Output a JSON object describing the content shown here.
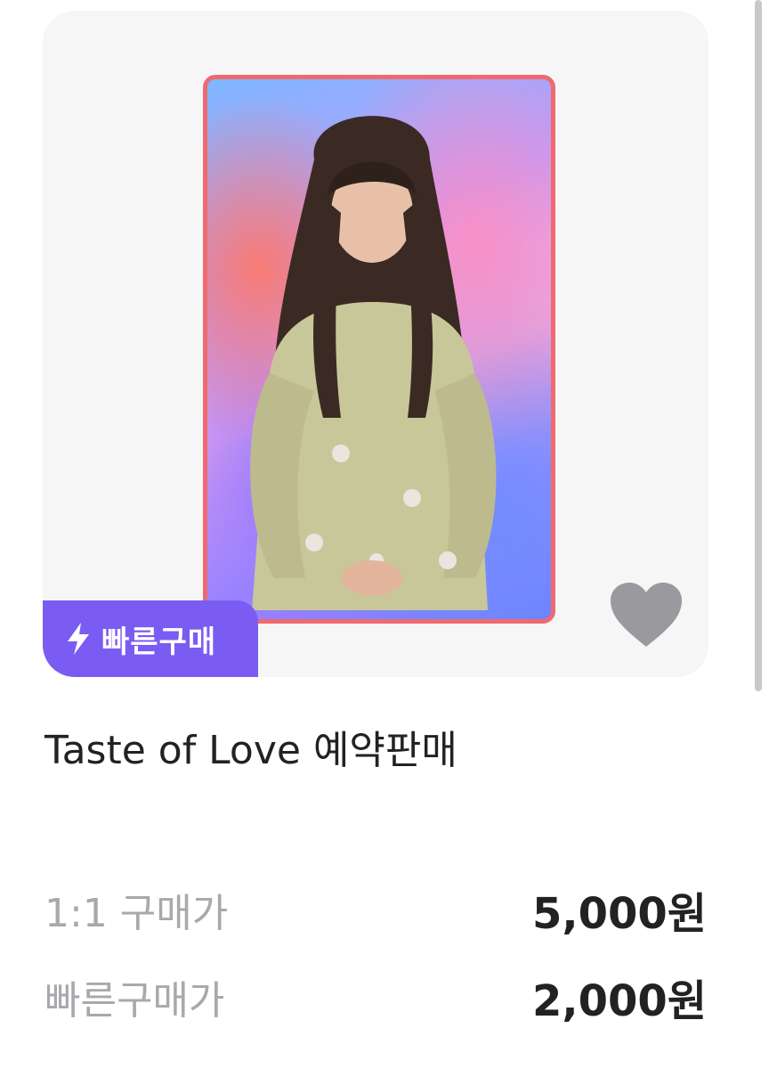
{
  "listing": {
    "badge_label": "빠른구매",
    "title": "Taste of Love 예약판매",
    "prices": [
      {
        "label": "1:1 구매가",
        "value": "5,000원"
      },
      {
        "label": "빠른구매가",
        "value": "2,000원"
      }
    ]
  },
  "icons": {
    "badge_icon": "lightning-bolt-icon",
    "favorite_icon": "heart-icon"
  },
  "colors": {
    "badge_bg": "#7a5cf2",
    "photo_border": "#ef6a6f",
    "heart": "#9a9a9e",
    "card_bg": "#f6f6f7"
  }
}
